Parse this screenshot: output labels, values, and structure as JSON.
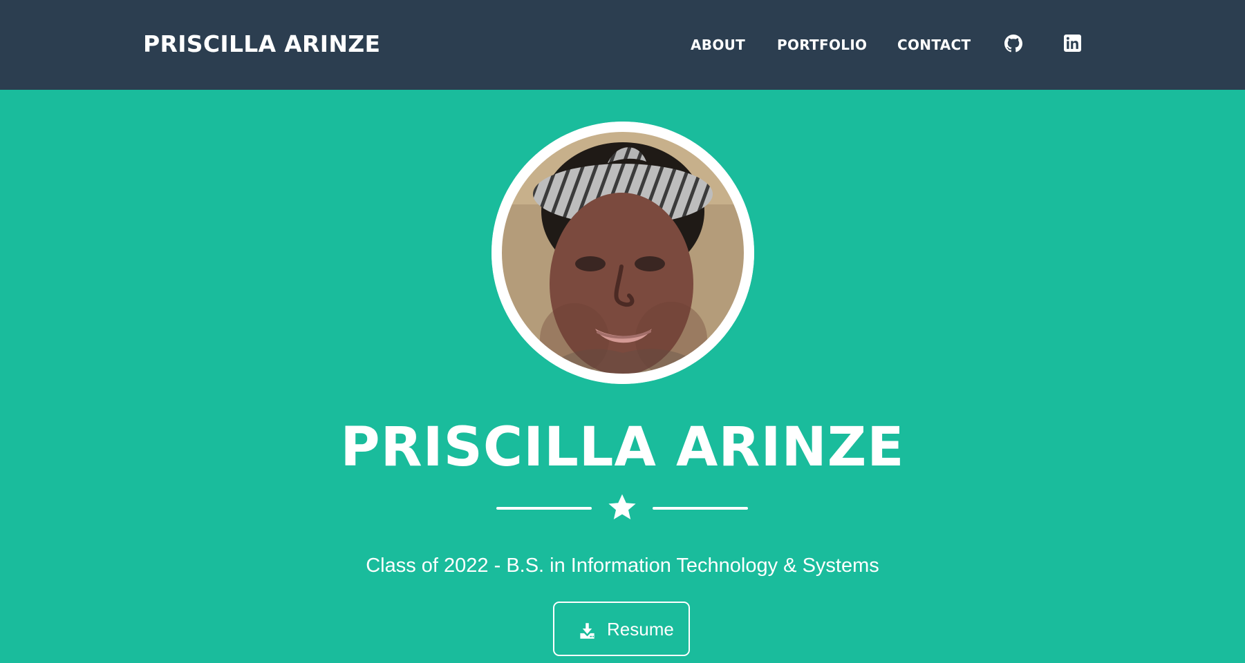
{
  "colors": {
    "navbar": "#2c3e50",
    "hero": "#1abc9c",
    "text": "#ffffff"
  },
  "header": {
    "brand": "PRISCILLA ARINZE",
    "links": [
      {
        "label": "ABOUT"
      },
      {
        "label": "PORTFOLIO"
      },
      {
        "label": "CONTACT"
      }
    ],
    "icons": [
      "github-icon",
      "linkedin-icon"
    ]
  },
  "hero": {
    "avatar_alt": "Profile photo",
    "title": "PRISCILLA ARINZE",
    "divider_icon": "star-icon",
    "subtitle": "Class of 2022 - B.S. in Information Technology & Systems",
    "resume_label": "Resume",
    "resume_icon": "download-icon"
  }
}
